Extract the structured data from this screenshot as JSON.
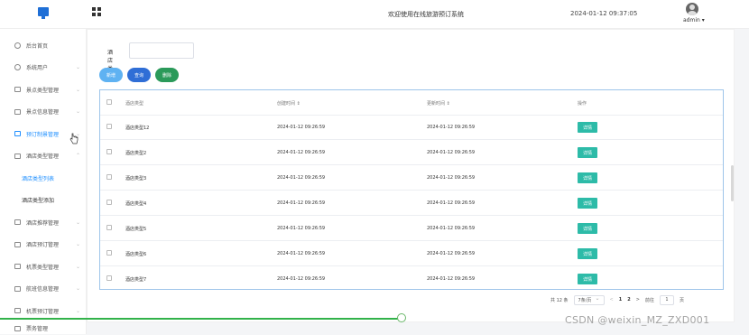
{
  "header": {
    "title": "欢迎使用在线旅游预订系统",
    "datetime": "2024-01-12 09:37:05",
    "user": "admin ▾"
  },
  "sidebar": {
    "items": [
      {
        "label": "后台首页"
      },
      {
        "label": "系统用户"
      },
      {
        "label": "景点类型管理"
      },
      {
        "label": "景点信息管理"
      },
      {
        "label": "预订制景管理"
      },
      {
        "label": "酒店类型管理"
      },
      {
        "label": "酒店类型列表"
      },
      {
        "label": "酒店类型添加"
      },
      {
        "label": "酒店推荐管理"
      },
      {
        "label": "酒店预订管理"
      },
      {
        "label": "机票类型管理"
      },
      {
        "label": "航班信息管理"
      },
      {
        "label": "机票预订管理"
      },
      {
        "label": "票务管理"
      }
    ]
  },
  "search": {
    "label": "酒店类型",
    "value": ""
  },
  "toolbar": {
    "add": "新增",
    "query": "查询",
    "delete": "删除"
  },
  "table": {
    "headers": [
      "酒店类型",
      "创建时间 ⇕",
      "更新时间 ⇕",
      "操作"
    ],
    "rows": [
      {
        "type": "酒店类型12",
        "created": "2024-01-12 09:26:59",
        "updated": "2024-01-12 09:26:59",
        "action": "详情"
      },
      {
        "type": "酒店类型2",
        "created": "2024-01-12 09:26:59",
        "updated": "2024-01-12 09:26:59",
        "action": "详情"
      },
      {
        "type": "酒店类型3",
        "created": "2024-01-12 09:26:59",
        "updated": "2024-01-12 09:26:59",
        "action": "详情"
      },
      {
        "type": "酒店类型4",
        "created": "2024-01-12 09:26:59",
        "updated": "2024-01-12 09:26:59",
        "action": "详情"
      },
      {
        "type": "酒店类型5",
        "created": "2024-01-12 09:26:59",
        "updated": "2024-01-12 09:26:59",
        "action": "详情"
      },
      {
        "type": "酒店类型6",
        "created": "2024-01-12 09:26:59",
        "updated": "2024-01-12 09:26:59",
        "action": "详情"
      },
      {
        "type": "酒店类型7",
        "created": "2024-01-12 09:26:59",
        "updated": "2024-01-12 09:26:59",
        "action": "详情"
      }
    ]
  },
  "pagination": {
    "total": "共 12 条",
    "page_size": "7条/页",
    "prev": "<",
    "page1": "1",
    "page2": "2",
    "next": ">",
    "goto_label": "前往",
    "goto_value": "1",
    "goto_suffix": "页"
  },
  "watermark": "CSDN @weixin_MZ_ZXD001"
}
